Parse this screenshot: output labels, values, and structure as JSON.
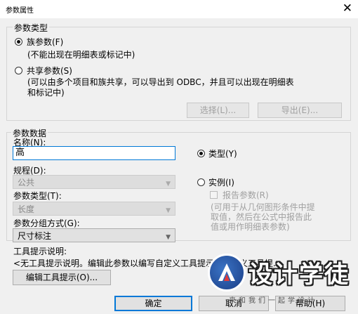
{
  "window": {
    "title": "参数属性",
    "close": "✕"
  },
  "param_type": {
    "legend": "参数类型",
    "family_label": "族参数(F)",
    "family_note": "(不能出现在明细表或标记中)",
    "shared_label": "共享参数(S)",
    "shared_note_line1": "(可以由多个项目和族共享，可以导出到 ODBC，并且可以出现在明细表",
    "shared_note_line2": "和标记中)",
    "select_button": "选择(L)...",
    "export_button": "导出(E)..."
  },
  "param_data": {
    "legend": "参数数据",
    "name_label": "名称(N):",
    "name_value": "高",
    "discipline_label": "规程(D):",
    "discipline_value": "公共",
    "param_type_label": "参数类型(T):",
    "param_type_value": "长度",
    "group_label": "参数分组方式(G):",
    "group_value": "尺寸标注",
    "type_radio": "类型(Y)",
    "instance_radio": "实例(I)",
    "report_param": "报告参数(R)",
    "report_note_line1": "(可用于从几何图形条件中提",
    "report_note_line2": "取值，然后在公式中报告此",
    "report_note_line3": "值或用作明细表参数)"
  },
  "tooltip": {
    "label": "工具提示说明:",
    "text": "<无工具提示说明。编辑此参数以编写自定义工具提示。自定义工具提...",
    "edit_button": "编辑工具提示(O)..."
  },
  "footer": {
    "ok_button": "确定",
    "cancel_button": "取消",
    "help_button": "帮助(H)"
  },
  "watermark": {
    "title": "设计学徒",
    "subtitle": "来和我们一起学设计"
  },
  "colors": {
    "accent": "#0078d7",
    "background": "#f0f0f0"
  }
}
